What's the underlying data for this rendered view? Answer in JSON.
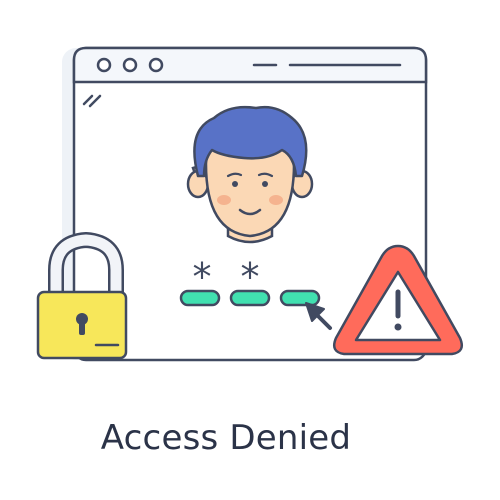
{
  "caption": "Access Denied",
  "password_mask": [
    "*",
    "*"
  ],
  "icons": {
    "user": "user-avatar-icon",
    "lock": "padlock-icon",
    "warning": "warning-triangle-icon",
    "cursor": "mouse-pointer-icon"
  },
  "colors": {
    "outline": "#414a61",
    "window_bg": "#ffffff",
    "window_shadow": "#eef2f7",
    "titlebar": "#f4f7fb",
    "hair": "#5872c7",
    "skin": "#fbd8b5",
    "cheek": "#f5b38f",
    "lock_body": "#f7e75a",
    "lock_shackle": "#f2f4f8",
    "warning_fill": "#ff6b5b",
    "warning_inner": "#ffffff",
    "password_dot": "#41e0b0"
  }
}
